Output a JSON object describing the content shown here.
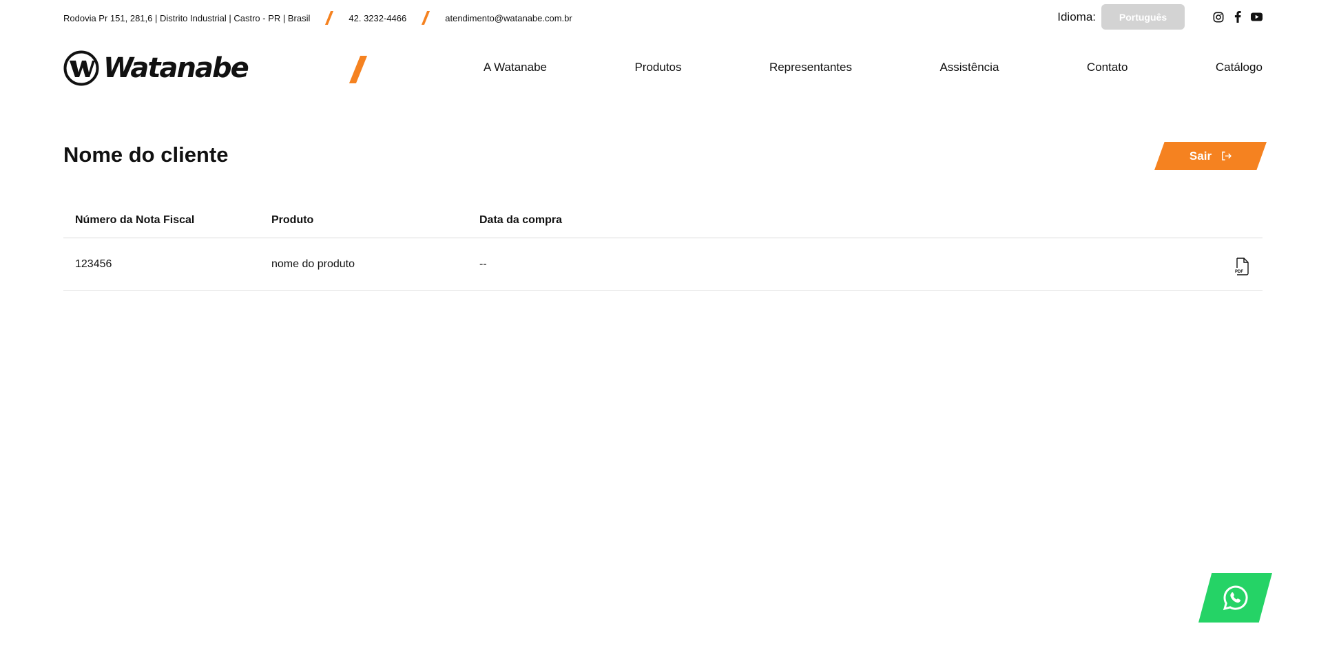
{
  "topbar": {
    "address": "Rodovia Pr 151, 281,6 | Distrito Industrial | Castro - PR | Brasil",
    "phone": "42. 3232-4466",
    "email": "atendimento@watanabe.com.br",
    "language_label": "Idioma:",
    "language_value": "Português"
  },
  "brand": {
    "name": "Watanabe",
    "accent": "#f58220"
  },
  "nav": {
    "items": [
      "A Watanabe",
      "Produtos",
      "Representantes",
      "Assistência",
      "Contato",
      "Catálogo"
    ]
  },
  "main": {
    "title": "Nome do cliente",
    "exit_label": "Sair"
  },
  "table": {
    "headers": [
      "Número da Nota Fiscal",
      "Produto",
      "Data da compra"
    ],
    "rows": [
      {
        "invoice": "123456",
        "product": "nome do produto",
        "date": "--"
      }
    ],
    "row_icon": "pdf-file-icon"
  },
  "icons": {
    "instagram": "instagram-icon",
    "facebook": "facebook-icon",
    "youtube": "youtube-icon",
    "whatsapp": "whatsapp-icon",
    "exit": "logout-icon"
  },
  "colors": {
    "accent": "#f58220",
    "whatsapp": "#25d366",
    "language_button": "#d3d3d3"
  }
}
